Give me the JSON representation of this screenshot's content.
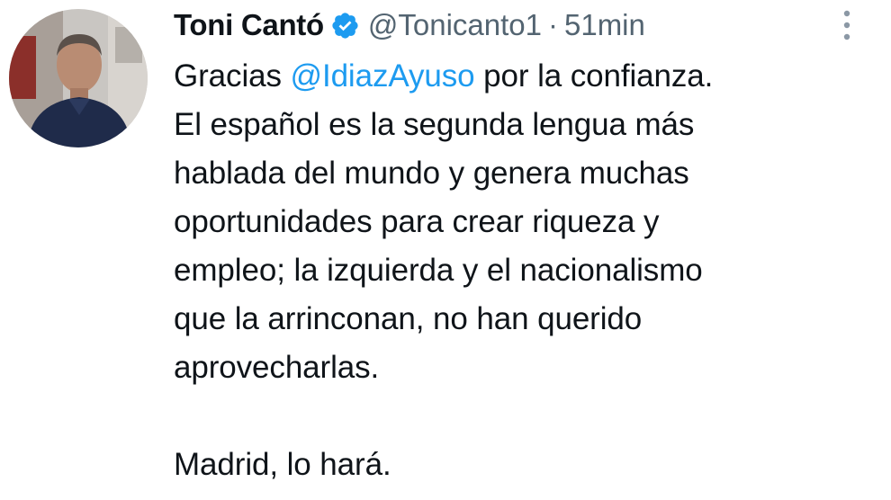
{
  "tweet": {
    "display_name": "Toni Cantó",
    "handle": "@Tonicanto1",
    "separator": "·",
    "time": "51min",
    "verified_icon": "verified-badge-icon",
    "more_icon": "more-vertical-icon",
    "lines": [
      {
        "before": "Gracias ",
        "mention": "@IdiazAyuso",
        "after": " por la confianza."
      },
      {
        "text": "El español es la segunda lengua más"
      },
      {
        "text": "hablada del mundo y genera muchas"
      },
      {
        "text": "oportunidades para crear riqueza y"
      },
      {
        "text": "empleo; la izquierda y el nacionalismo"
      },
      {
        "text": "que la arrinconan, no han querido"
      },
      {
        "text": "aprovecharlas."
      },
      {
        "text": "Madrid, lo hará."
      }
    ]
  },
  "colors": {
    "accent": "#1d9bf0",
    "text": "#0f1419",
    "muted": "#536471"
  }
}
